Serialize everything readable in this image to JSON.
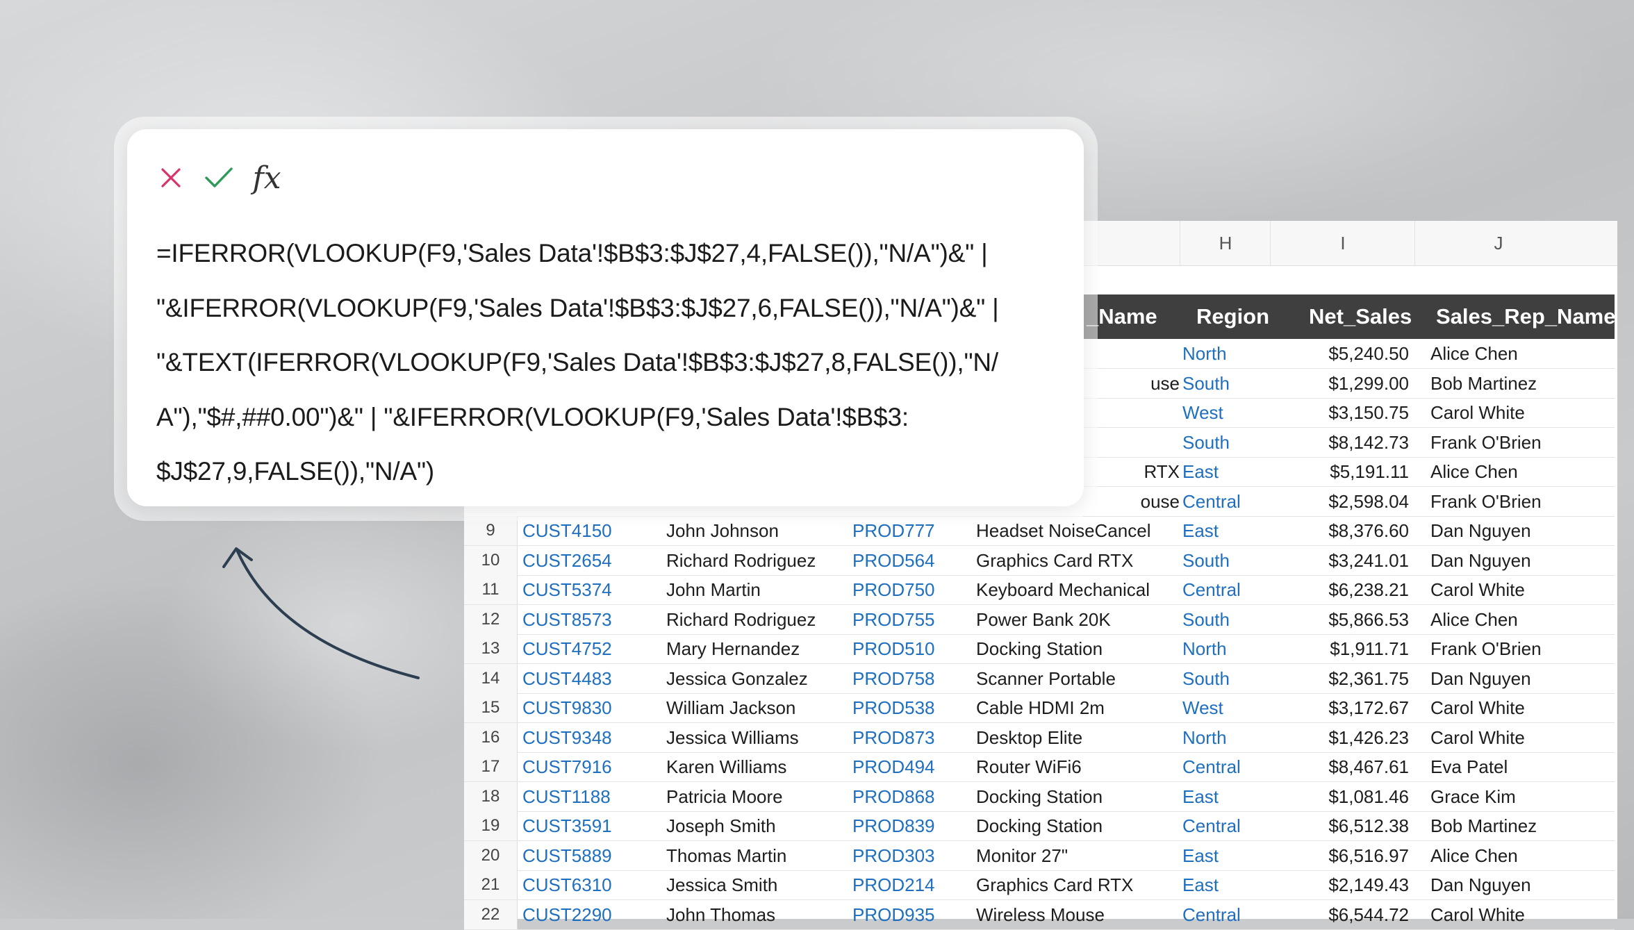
{
  "formula_bar": {
    "cancel_icon": "x-icon",
    "confirm_icon": "check-icon",
    "function_icon": "fx-icon",
    "function_label": "fx",
    "formula_lines": [
      "=IFERROR(VLOOKUP(F9,'Sales Data'!$B$3:$J$27,4,FALSE()),\"N/A\")&\" |",
      "\"&IFERROR(VLOOKUP(F9,'Sales Data'!$B$3:$J$27,6,FALSE()),\"N/A\")&\" |",
      "\"&TEXT(IFERROR(VLOOKUP(F9,'Sales Data'!$B$3:$J$27,8,FALSE()),\"N/",
      "A\"),\"$#,##0.00\")&\" | \"&IFERROR(VLOOKUP(F9,'Sales Data'!$B$3:",
      "$J$27,9,FALSE()),\"N/A\")"
    ]
  },
  "spreadsheet": {
    "column_letters": [
      "H",
      "I",
      "J"
    ],
    "headers": {
      "product_name": "_Name",
      "region": "Region",
      "net_sales": "Net_Sales",
      "sales_rep": "Sales_Rep_Name"
    },
    "partial_rows": [
      {
        "product": "",
        "region": "North",
        "net_sales": "$5,240.50",
        "rep": "Alice Chen"
      },
      {
        "product": "use",
        "region": "South",
        "net_sales": "$1,299.00",
        "rep": "Bob Martinez"
      },
      {
        "product": "",
        "region": "West",
        "net_sales": "$3,150.75",
        "rep": "Carol White"
      },
      {
        "product": "",
        "region": "South",
        "net_sales": "$8,142.73",
        "rep": "Frank O'Brien"
      },
      {
        "product": "RTX",
        "region": "East",
        "net_sales": "$5,191.11",
        "rep": "Alice Chen"
      },
      {
        "product": "ouse",
        "region": "Central",
        "net_sales": "$2,598.04",
        "rep": "Frank O'Brien"
      }
    ],
    "rows": [
      {
        "n": "9",
        "cust": "CUST4150",
        "name": "John Johnson",
        "prod": "PROD777",
        "product": "Headset NoiseCancel",
        "region": "East",
        "net_sales": "$8,376.60",
        "rep": "Dan Nguyen"
      },
      {
        "n": "10",
        "cust": "CUST2654",
        "name": "Richard Rodriguez",
        "prod": "PROD564",
        "product": "Graphics Card RTX",
        "region": "South",
        "net_sales": "$3,241.01",
        "rep": "Dan Nguyen"
      },
      {
        "n": "11",
        "cust": "CUST5374",
        "name": "John Martin",
        "prod": "PROD750",
        "product": "Keyboard Mechanical",
        "region": "Central",
        "net_sales": "$6,238.21",
        "rep": "Carol White"
      },
      {
        "n": "12",
        "cust": "CUST8573",
        "name": "Richard Rodriguez",
        "prod": "PROD755",
        "product": "Power Bank 20K",
        "region": "South",
        "net_sales": "$5,866.53",
        "rep": "Alice Chen"
      },
      {
        "n": "13",
        "cust": "CUST4752",
        "name": "Mary Hernandez",
        "prod": "PROD510",
        "product": "Docking Station",
        "region": "North",
        "net_sales": "$1,911.71",
        "rep": "Frank O'Brien"
      },
      {
        "n": "14",
        "cust": "CUST4483",
        "name": "Jessica Gonzalez",
        "prod": "PROD758",
        "product": "Scanner Portable",
        "region": "South",
        "net_sales": "$2,361.75",
        "rep": "Dan Nguyen"
      },
      {
        "n": "15",
        "cust": "CUST9830",
        "name": "William Jackson",
        "prod": "PROD538",
        "product": "Cable HDMI 2m",
        "region": "West",
        "net_sales": "$3,172.67",
        "rep": "Carol White"
      },
      {
        "n": "16",
        "cust": "CUST9348",
        "name": "Jessica Williams",
        "prod": "PROD873",
        "product": "Desktop Elite",
        "region": "North",
        "net_sales": "$1,426.23",
        "rep": "Carol White"
      },
      {
        "n": "17",
        "cust": "CUST7916",
        "name": "Karen Williams",
        "prod": "PROD494",
        "product": "Router WiFi6",
        "region": "Central",
        "net_sales": "$8,467.61",
        "rep": "Eva Patel"
      },
      {
        "n": "18",
        "cust": "CUST1188",
        "name": "Patricia Moore",
        "prod": "PROD868",
        "product": "Docking Station",
        "region": "East",
        "net_sales": "$1,081.46",
        "rep": "Grace Kim"
      },
      {
        "n": "19",
        "cust": "CUST3591",
        "name": "Joseph Smith",
        "prod": "PROD839",
        "product": "Docking Station",
        "region": "Central",
        "net_sales": "$6,512.38",
        "rep": "Bob Martinez"
      },
      {
        "n": "20",
        "cust": "CUST5889",
        "name": "Thomas Martin",
        "prod": "PROD303",
        "product": "Monitor 27\"",
        "region": "East",
        "net_sales": "$6,516.97",
        "rep": "Alice Chen"
      },
      {
        "n": "21",
        "cust": "CUST6310",
        "name": "Jessica Smith",
        "prod": "PROD214",
        "product": "Graphics Card RTX",
        "region": "East",
        "net_sales": "$2,149.43",
        "rep": "Dan Nguyen"
      },
      {
        "n": "22",
        "cust": "CUST2290",
        "name": "John Thomas",
        "prod": "PROD935",
        "product": "Wireless Mouse",
        "region": "Central",
        "net_sales": "$6,544.72",
        "rep": "Carol White"
      }
    ]
  },
  "colors": {
    "header_band": "#3f3f3f",
    "link_blue": "#1f6fc1",
    "cancel_red": "#d8336a",
    "confirm_green": "#2e9a5a",
    "arrow": "#2c3e50"
  }
}
